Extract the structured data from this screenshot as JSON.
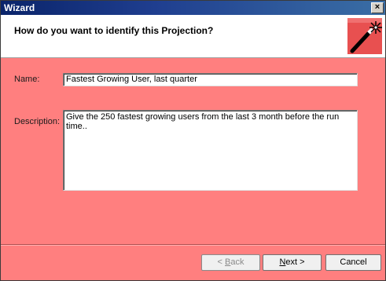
{
  "window": {
    "title": "Wizard",
    "close_glyph": "×"
  },
  "header": {
    "title": "How do you want to identify this Projection?",
    "icon": "magic-wand-icon"
  },
  "form": {
    "name_label": "Name:",
    "name_value": "Fastest Growing User, last quarter",
    "description_label": "Description:",
    "description_value": "Give the 250 fastest growing users from the last 3 month before the run time.."
  },
  "buttons": {
    "back_prefix": "< ",
    "back_accel": "B",
    "back_rest": "ack",
    "next_accel": "N",
    "next_rest": "ext >",
    "cancel": "Cancel"
  },
  "colors": {
    "body_background": "#ff7f7f",
    "titlebar": "#0a246a",
    "header_background": "#ffffff"
  }
}
